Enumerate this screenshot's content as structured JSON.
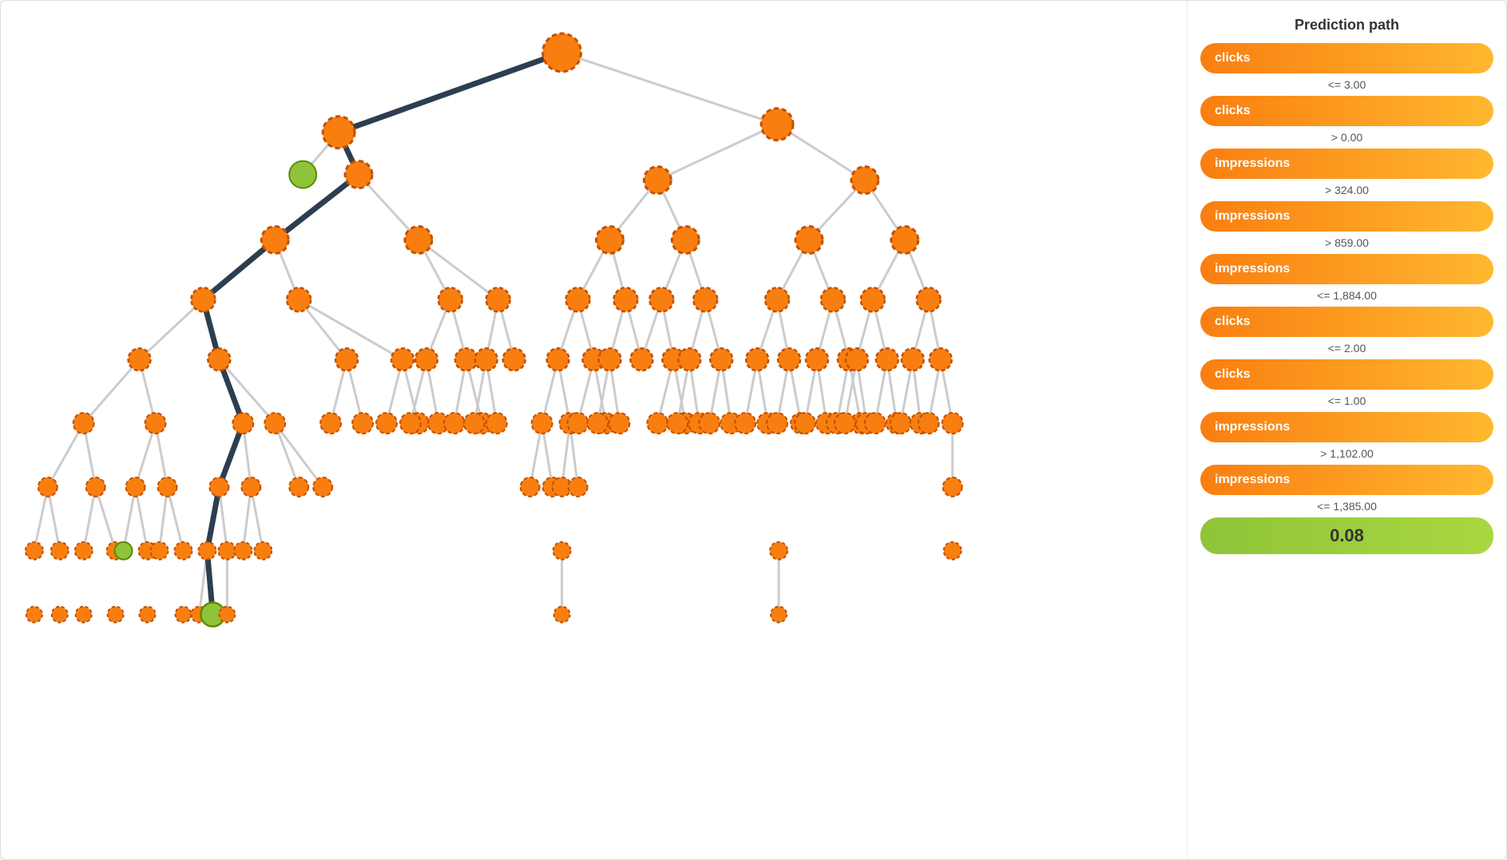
{
  "sidebar": {
    "title": "Prediction path",
    "items": [
      {
        "label": "clicks",
        "type": "orange"
      },
      {
        "condition": "<= 3.00"
      },
      {
        "label": "clicks",
        "type": "orange"
      },
      {
        "condition": "> 0.00"
      },
      {
        "label": "impressions",
        "type": "orange"
      },
      {
        "condition": "> 324.00"
      },
      {
        "label": "impressions",
        "type": "orange"
      },
      {
        "condition": "> 859.00"
      },
      {
        "label": "impressions",
        "type": "orange"
      },
      {
        "condition": "<= 1,884.00"
      },
      {
        "label": "clicks",
        "type": "orange"
      },
      {
        "condition": "<= 2.00"
      },
      {
        "label": "clicks",
        "type": "orange"
      },
      {
        "condition": "<= 1.00"
      },
      {
        "label": "impressions",
        "type": "orange"
      },
      {
        "condition": "> 1,102.00"
      },
      {
        "label": "impressions",
        "type": "orange"
      },
      {
        "condition": "<= 1,385.00"
      },
      {
        "label": "0.08",
        "type": "green"
      }
    ]
  }
}
